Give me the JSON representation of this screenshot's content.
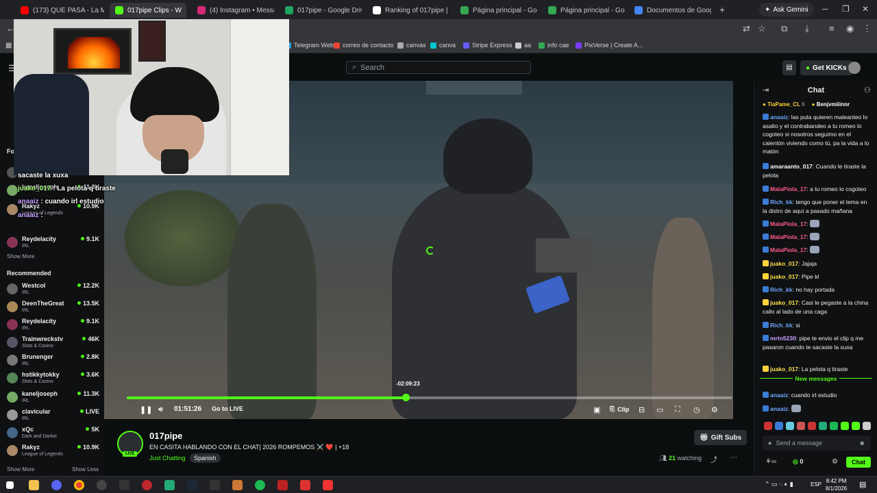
{
  "browser": {
    "tabs": [
      {
        "title": "(173) QUE PASA - La M",
        "color": "#ff0000"
      },
      {
        "title": "017pipe Clips - W",
        "color": "#53fc18",
        "active": true
      },
      {
        "title": "(4) Instagram • Messa",
        "color": "#d62976"
      },
      {
        "title": "017pipe - Google Driv",
        "color": "#1fa463"
      },
      {
        "title": "Ranking of 017pipe | E",
        "color": "#ffffff"
      },
      {
        "title": "Página principal - Goo",
        "color": "#34a853"
      },
      {
        "title": "Página principal - Goo",
        "color": "#34a853"
      },
      {
        "title": "Documentos de Goog",
        "color": "#4285f4"
      }
    ],
    "ask_gemini": "Ask Gemini",
    "bookmarks": [
      {
        "label": "Telegram Web",
        "color": "#2aa3df"
      },
      {
        "label": "correo de contacto",
        "color": "#ea4335"
      },
      {
        "label": "canvas",
        "color": "#aaaaaa"
      },
      {
        "label": "canva",
        "color": "#00c4cc"
      },
      {
        "label": "Stripe Express",
        "color": "#635bff"
      },
      {
        "label": "aa",
        "color": "#cccccc"
      },
      {
        "label": "info cae",
        "color": "#34a853"
      },
      {
        "label": "PixVerse | Create A...",
        "color": "#7a3cff"
      }
    ]
  },
  "kick": {
    "search_placeholder": "Search",
    "get_kicks": "Get KICKs"
  },
  "sidebar": {
    "following_label": "Fo",
    "following": [
      {
        "name": "Westcol",
        "viewers": "12.2K",
        "color": "#555"
      },
      {
        "name": "kaneljoseph",
        "viewers": "11.3K",
        "color": "#7a6"
      },
      {
        "name": "Rakyz",
        "category": "League of Legends",
        "viewers": "10.9K",
        "color": "#a86"
      },
      {
        "name": "Reydelacity",
        "category": "IRL",
        "viewers": "9.1K",
        "color": "#835"
      }
    ],
    "show_more_1": "Show More",
    "recommended_label": "Recommended",
    "recommended": [
      {
        "name": "Westcol",
        "category": "IRL",
        "viewers": "12.2K",
        "color": "#666"
      },
      {
        "name": "DeenTheGreat",
        "category": "IRL",
        "viewers": "13.5K",
        "color": "#a85"
      },
      {
        "name": "Reydelacity",
        "category": "IRL",
        "viewers": "9.1K",
        "color": "#835"
      },
      {
        "name": "Trainwreckstv",
        "category": "Slots & Casino",
        "viewers": "46K",
        "color": "#556"
      },
      {
        "name": "Brunenger",
        "category": "IRL",
        "viewers": "2.8K",
        "color": "#777"
      },
      {
        "name": "hstikkytokky",
        "category": "Slots & Casino",
        "viewers": "3.6K",
        "color": "#585"
      },
      {
        "name": "kaneljoseph",
        "category": "IRL",
        "viewers": "11.3K",
        "color": "#7a6"
      },
      {
        "name": "clavicular",
        "category": "IRL",
        "viewers": "LIVE",
        "color": "#999"
      },
      {
        "name": "xQc",
        "category": "Dark and Darker",
        "viewers": "5K",
        "color": "#468"
      },
      {
        "name": "Rakyz",
        "category": "League of Legends",
        "viewers": "10.9K",
        "color": "#a86"
      }
    ],
    "show_more_2": "Show More",
    "show_less": "Show Less"
  },
  "overlay": {
    "lines": [
      {
        "text": "sacaste la xuxa"
      },
      {
        "user": "juako_017",
        "text": " : La pelota q tiraste"
      },
      {
        "user": "anaaiz",
        "text": " : cuando irl estudio"
      },
      {
        "user": "anaaiz",
        "text": " : "
      }
    ]
  },
  "player": {
    "time_tooltip": "-02:09:23",
    "elapsed": "01:51:26",
    "go_live": "Go to LIVE",
    "clip": "Clip",
    "progress_fraction": 0.46
  },
  "stream": {
    "streamer": "017pipe",
    "live_badge": "LIVE",
    "title": "EN CASITA HABLANDO CON EL CHAT| 2026 ROMPEMOS ⚔️ ❤️ | +18",
    "category": "Just Chatting",
    "language": "Spanish",
    "watching_count": "21",
    "watching_label": "watching",
    "gift_subs": "Gift Subs"
  },
  "chat": {
    "title": "Chat",
    "pinned": [
      {
        "user": "TiaPame_CL",
        "n": "6"
      },
      {
        "user": "Benjvmiiinnr"
      }
    ],
    "messages": [
      {
        "user": "anaaiz",
        "color": "#6fa8ff",
        "text": "las puta quieren maleanteo lo asalto y el contrabandeo a tu romeo lo cogoteo si nosotros seguimo en el calentón viviendo como tú, pa la vida a lo matón"
      },
      {
        "user": "amaraanto_017",
        "color": "#ffffff",
        "text": "Cuando le tiraste la pelota"
      },
      {
        "user": "MalaPiola_17",
        "color": "#ff5c8a",
        "text": "a tu romeo lo cogoteo"
      },
      {
        "user": "Rich_kk",
        "color": "#6fa8ff",
        "text": "tengo que poner el tema en la distro de aquí a pasado mañana"
      },
      {
        "user": "MalaPiola_17",
        "color": "#ff5c8a",
        "text": ""
      },
      {
        "user": "MalaPiola_17",
        "color": "#ff5c8a",
        "text": ""
      },
      {
        "user": "MalaPiola_17",
        "color": "#ff5c8a",
        "text": ""
      },
      {
        "user": "juako_017",
        "color": "#ffe14d",
        "text": "Jajaja"
      },
      {
        "user": "juako_017",
        "color": "#ffe14d",
        "text": "Pipe kl"
      },
      {
        "user": "Rich_kk",
        "color": "#6fa8ff",
        "text": "no hay portada"
      },
      {
        "user": "juako_017",
        "color": "#ffe14d",
        "text": "Casi le pegaste a la china callo al lado de una caga"
      },
      {
        "user": "Rich_kk",
        "color": "#6fa8ff",
        "text": "si"
      },
      {
        "user": "mrtn5230",
        "color": "#c8a0ff",
        "text": "pipe te envio el clip q me pasaron cuando te sacaste la xuxa"
      },
      {
        "user": "juako_017",
        "color": "#ffe14d",
        "text": "La pelota q tiraste"
      }
    ],
    "new_messages": "New messages",
    "after": [
      {
        "user": "anaaiz",
        "color": "#6fa8ff",
        "text": "cuando irl estudio"
      },
      {
        "user": "anaaiz",
        "color": "#6fa8ff",
        "text": ""
      }
    ],
    "input_placeholder": "Send a message",
    "kicks_count": "0",
    "send_label": "Chat"
  },
  "taskbar": {
    "lang": "ESP",
    "time": "8:42 PM",
    "date": "8/1/2026"
  }
}
